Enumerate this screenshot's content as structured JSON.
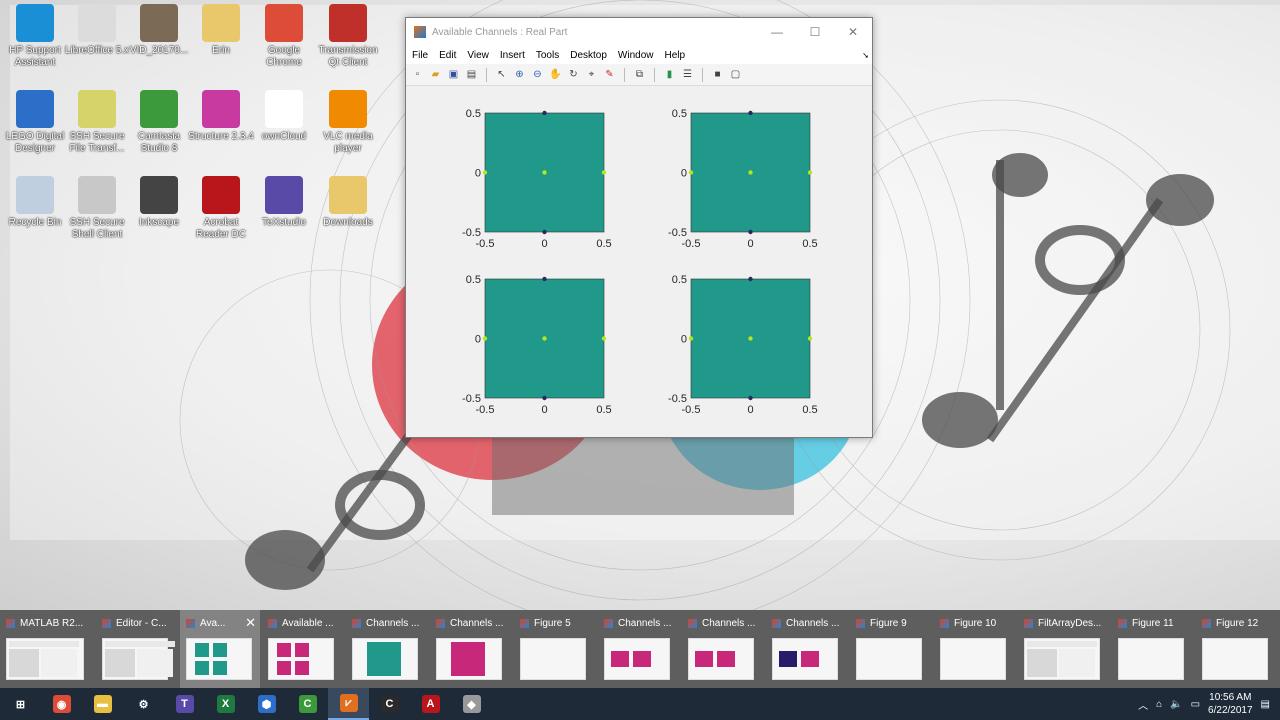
{
  "desktop_icons": [
    {
      "label": "HP Support Assistant",
      "icon": "hp-support-icon",
      "color": "#1b8fd6"
    },
    {
      "label": "LibreOffice 5.x",
      "icon": "libreoffice-icon",
      "color": "#dcdcdc"
    },
    {
      "label": "VID_20170...",
      "icon": "video-file-icon",
      "color": "#7b6a55"
    },
    {
      "label": "Erin",
      "icon": "folder-icon",
      "color": "#e8c86a"
    },
    {
      "label": "Google Chrome",
      "icon": "chrome-icon",
      "color": "#dd4b39"
    },
    {
      "label": "Transmission Qt Client",
      "icon": "transmission-icon",
      "color": "#c0302a"
    },
    {
      "label": "LEGO Digital Designer",
      "icon": "lego-icon",
      "color": "#2b6fc8"
    },
    {
      "label": "SSH Secure File Transf...",
      "icon": "ssh-transfer-icon",
      "color": "#d6d36a"
    },
    {
      "label": "Camtasia Studio 8",
      "icon": "camtasia-icon",
      "color": "#3c9a3c"
    },
    {
      "label": "Structure 2.3.4",
      "icon": "structure-icon",
      "color": "#c83aa0"
    },
    {
      "label": "ownCloud",
      "icon": "owncloud-icon",
      "color": "#ffffff"
    },
    {
      "label": "VLC media player",
      "icon": "vlc-icon",
      "color": "#f08a00"
    },
    {
      "label": "Recycle Bin",
      "icon": "recycle-bin-icon",
      "color": "#bfcfe0"
    },
    {
      "label": "SSH Secure Shell Client",
      "icon": "ssh-shell-icon",
      "color": "#c8c8c8"
    },
    {
      "label": "Inkscape",
      "icon": "inkscape-icon",
      "color": "#444444"
    },
    {
      "label": "Acrobat Reader DC",
      "icon": "acrobat-icon",
      "color": "#b8161b"
    },
    {
      "label": "TeXstudio",
      "icon": "texstudio-icon",
      "color": "#5a4aa8"
    },
    {
      "label": "Downloads",
      "icon": "folder-icon",
      "color": "#e8c86a"
    }
  ],
  "figure": {
    "title": "Available Channels : Real Part",
    "menu": [
      "File",
      "Edit",
      "View",
      "Insert",
      "Tools",
      "Desktop",
      "Window",
      "Help"
    ],
    "toolbar_icons": [
      "new-figure-icon",
      "open-file-icon",
      "save-icon",
      "print-icon",
      "edit-plot-arrow-icon",
      "zoom-in-icon",
      "zoom-out-icon",
      "pan-hand-icon",
      "rotate-3d-icon",
      "data-cursor-icon",
      "brush-icon",
      "link-plot-icon",
      "insert-colorbar-icon",
      "insert-legend-icon",
      "hide-plot-tools-icon",
      "show-plot-tools-icon"
    ],
    "fill_color": "#20998a",
    "dot_color": "#b5e61d",
    "edge_dot_color": "#2a2a60"
  },
  "chart_data": [
    {
      "type": "heatmap",
      "title": "",
      "xticks": [
        "-0.5",
        "0",
        "0.5"
      ],
      "yticks": [
        "0.5",
        "0",
        "-0.5"
      ],
      "xlim": [
        -0.5,
        0.5
      ],
      "ylim": [
        -0.5,
        0.5
      ]
    },
    {
      "type": "heatmap",
      "title": "",
      "xticks": [
        "-0.5",
        "0",
        "0.5"
      ],
      "yticks": [
        "0.5",
        "0",
        "-0.5"
      ],
      "xlim": [
        -0.5,
        0.5
      ],
      "ylim": [
        -0.5,
        0.5
      ]
    },
    {
      "type": "heatmap",
      "title": "",
      "xticks": [
        "-0.5",
        "0",
        "0.5"
      ],
      "yticks": [
        "0.5",
        "0",
        "-0.5"
      ],
      "xlim": [
        -0.5,
        0.5
      ],
      "ylim": [
        -0.5,
        0.5
      ]
    },
    {
      "type": "heatmap",
      "title": "",
      "xticks": [
        "-0.5",
        "0",
        "0.5"
      ],
      "yticks": [
        "0.5",
        "0",
        "-0.5"
      ],
      "xlim": [
        -0.5,
        0.5
      ],
      "ylim": [
        -0.5,
        0.5
      ]
    }
  ],
  "taskbar_previews": [
    {
      "label": "MATLAB R2...",
      "preview": "screen"
    },
    {
      "label": "Editor - C...",
      "preview": "screen"
    },
    {
      "label": "Ava...",
      "preview": "teal-grid",
      "active": true
    },
    {
      "label": "Available ...",
      "preview": "pink-grid"
    },
    {
      "label": "Channels ...",
      "preview": "teal-square"
    },
    {
      "label": "Channels ...",
      "preview": "pink-square"
    },
    {
      "label": "Figure 5",
      "preview": "blank"
    },
    {
      "label": "Channels ...",
      "preview": "pink-pair"
    },
    {
      "label": "Channels ...",
      "preview": "pink-pair"
    },
    {
      "label": "Channels ...",
      "preview": "navy-pink-pair"
    },
    {
      "label": "Figure 9",
      "preview": "blank"
    },
    {
      "label": "Figure 10",
      "preview": "blank"
    },
    {
      "label": "FiltArrayDes...",
      "preview": "screen"
    },
    {
      "label": "Figure 11",
      "preview": "blank"
    },
    {
      "label": "Figure 12",
      "preview": "blank"
    }
  ],
  "taskbar": {
    "pinned": [
      {
        "icon": "windows-start-icon",
        "color": "#1e2a38"
      },
      {
        "icon": "chrome-icon",
        "color": "#dd4b39"
      },
      {
        "icon": "file-explorer-icon",
        "color": "#e8c040"
      },
      {
        "icon": "settings-gear-icon",
        "color": "#1e2a38"
      },
      {
        "icon": "texstudio-icon",
        "color": "#5a4aa8"
      },
      {
        "icon": "excel-icon",
        "color": "#1e7a40"
      },
      {
        "icon": "network-app-icon",
        "color": "#2b6fc8"
      },
      {
        "icon": "camtasia-icon",
        "color": "#3c9a3c"
      },
      {
        "icon": "matlab-icon",
        "color": "#e07020"
      },
      {
        "icon": "camtasia-recorder-icon",
        "color": "#2a2a2a"
      },
      {
        "icon": "acrobat-icon",
        "color": "#b8161b"
      },
      {
        "icon": "shield-app-icon",
        "color": "#999999"
      }
    ],
    "time": "10:56 AM",
    "date": "6/22/2017"
  }
}
